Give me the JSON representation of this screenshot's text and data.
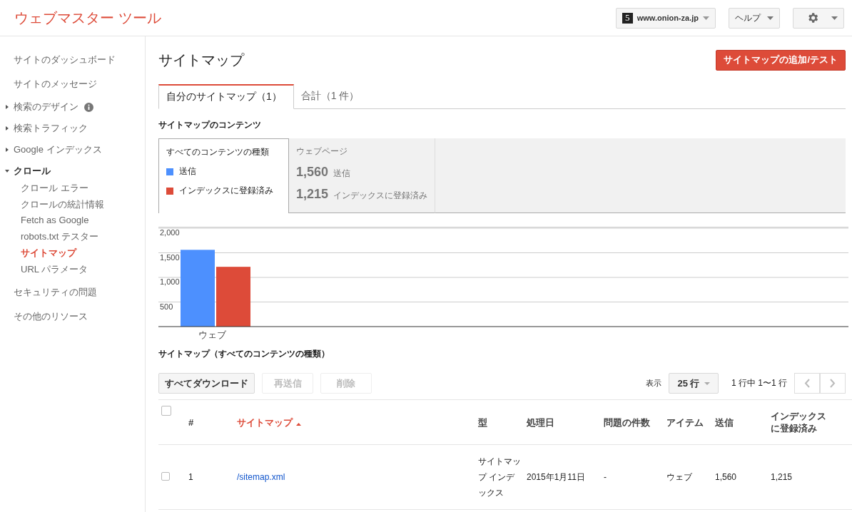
{
  "header": {
    "title": "ウェブマスター ツール",
    "site": "www.onion-za.jp",
    "site_logo": "5",
    "help": "ヘルプ"
  },
  "sidebar": {
    "items": [
      {
        "label": "サイトのダッシュボード",
        "kind": "link",
        "selected": false
      },
      {
        "label": "サイトのメッセージ",
        "kind": "link",
        "selected": false
      },
      {
        "label": "検索のデザイン",
        "kind": "group",
        "expanded": false,
        "info": true,
        "selected": false
      },
      {
        "label": "検索トラフィック",
        "kind": "group",
        "expanded": false,
        "info": false,
        "selected": false
      },
      {
        "label": "Google インデックス",
        "kind": "group",
        "expanded": false,
        "info": false,
        "selected": false
      },
      {
        "label": "クロール",
        "kind": "group",
        "expanded": true,
        "info": false,
        "selected": false,
        "children": [
          {
            "label": "クロール エラー",
            "selected": false
          },
          {
            "label": "クロールの統計情報",
            "selected": false
          },
          {
            "label": "Fetch as Google",
            "selected": false
          },
          {
            "label": "robots.txt テスター",
            "selected": false
          },
          {
            "label": "サイトマップ",
            "selected": true
          },
          {
            "label": "URL パラメータ",
            "selected": false
          }
        ]
      },
      {
        "label": "セキュリティの問題",
        "kind": "link",
        "selected": false
      },
      {
        "label": "その他のリソース",
        "kind": "link",
        "selected": false
      }
    ]
  },
  "page": {
    "title": "サイトマップ",
    "add_button": "サイトマップの追加/テスト"
  },
  "tabs": [
    {
      "label": "自分のサイトマップ（1）",
      "selected": true
    },
    {
      "label": "合計（1 件）",
      "selected": false
    }
  ],
  "contents": {
    "heading": "サイトマップのコンテンツ",
    "panels": [
      {
        "kind": "legend",
        "title": "すべてのコンテンツの種類",
        "selected": true
      },
      {
        "kind": "stats",
        "title": "ウェブページ",
        "selected": false,
        "stats": [
          {
            "value": "1,560",
            "label": "送信"
          },
          {
            "value": "1,215",
            "label": "インデックスに登録済み"
          }
        ]
      }
    ],
    "chart_data": {
      "type": "bar",
      "grid": true,
      "categories": [
        "ウェブ"
      ],
      "series": [
        {
          "name": "送信",
          "color": "#4d90fe",
          "values": [
            1560
          ]
        },
        {
          "name": "インデックスに登録済み",
          "color": "#dd4b39",
          "values": [
            1215
          ]
        }
      ],
      "ylim": [
        0,
        2000
      ],
      "yticks": [
        {
          "value": 500,
          "label": "500"
        },
        {
          "value": 1000,
          "label": "1,000"
        },
        {
          "value": 1500,
          "label": "1,500"
        },
        {
          "value": 2000,
          "label": "2,000"
        }
      ]
    }
  },
  "sitemaps": {
    "heading": "サイトマップ（すべてのコンテンツの種類）",
    "buttons": [
      {
        "label": "すべてダウンロード",
        "disabled": false
      },
      {
        "label": "再送信",
        "disabled": true
      },
      {
        "label": "削除",
        "disabled": true
      }
    ],
    "select_all_checked": false,
    "show_label": "表示",
    "rows_select": "25 行",
    "range": "1 行中 1〜1 行",
    "columns": [
      {
        "label": "#",
        "sorted": false
      },
      {
        "label": "サイトマップ",
        "sorted": true
      },
      {
        "label": "型",
        "sorted": false
      },
      {
        "label": "処理日",
        "sorted": false
      },
      {
        "label": "問題の件数",
        "sorted": false
      },
      {
        "label": "アイテム",
        "sorted": false
      },
      {
        "label": "送信",
        "sorted": false
      },
      {
        "label": "インデックスに登録済み",
        "sorted": false
      }
    ],
    "rows": [
      {
        "checked": false,
        "cells": [
          "1",
          "/sitemap.xml",
          "サイトマップ インデックス",
          "2015年1月11日",
          "-",
          "ウェブ",
          "1,560",
          "1,215"
        ]
      }
    ]
  }
}
